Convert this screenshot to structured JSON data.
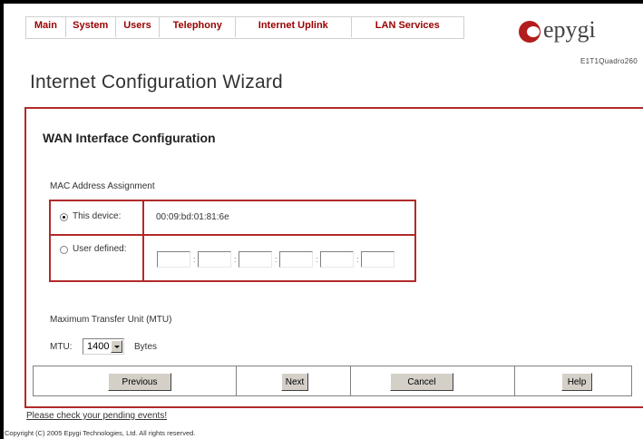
{
  "nav": {
    "items": [
      {
        "label": "Main"
      },
      {
        "label": "System"
      },
      {
        "label": "Users"
      },
      {
        "label": "Telephony"
      },
      {
        "label": "Internet Uplink"
      },
      {
        "label": "LAN Services"
      }
    ]
  },
  "brand": {
    "logo_text": "epygi",
    "model": "E1T1Quadro260"
  },
  "page": {
    "title": "Internet Configuration Wizard"
  },
  "wan": {
    "title": "WAN Interface Configuration",
    "mac_section_label": "MAC Address Assignment",
    "this_device_label": "This device:",
    "this_device_mac": "00:09:bd:01:81:6e",
    "user_defined_label": "User defined:",
    "selected_option": "This device",
    "user_defined_octets": [
      "",
      "",
      "",
      "",
      "",
      ""
    ]
  },
  "mtu": {
    "section_label": "Maximum Transfer Unit (MTU)",
    "label": "MTU:",
    "value": "1400",
    "unit": "Bytes"
  },
  "buttons": {
    "previous": "Previous",
    "next": "Next",
    "cancel": "Cancel",
    "help": "Help"
  },
  "footer": {
    "pending_link": "Please check your pending events!",
    "copyright": "Copyright (C) 2005 Epygi Technologies, Ltd. All rights reserved."
  },
  "colors": {
    "accent": "#b22a2a",
    "nav_text": "#990000"
  },
  "icons": {
    "logo": "epygi-logo-icon",
    "dropdown": "chevron-down-icon"
  }
}
